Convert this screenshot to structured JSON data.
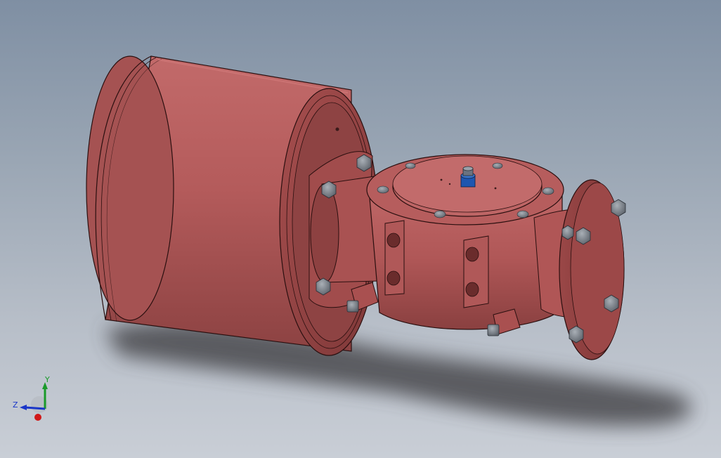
{
  "scene": {
    "model_color": "#b45a5a",
    "model_dark": "#8a3e3e",
    "model_light": "#c66e6e",
    "outline_color": "#2a0f0f",
    "bolt_color": "#7a8088",
    "fitting_color": "#1e56b0",
    "shadow_color": "#4a4a4e"
  },
  "triad": {
    "x_label": "",
    "y_label": "Y",
    "z_label": "Z",
    "x_color": "#d01818",
    "y_color": "#1a9a2a",
    "z_color": "#1a36c8"
  }
}
